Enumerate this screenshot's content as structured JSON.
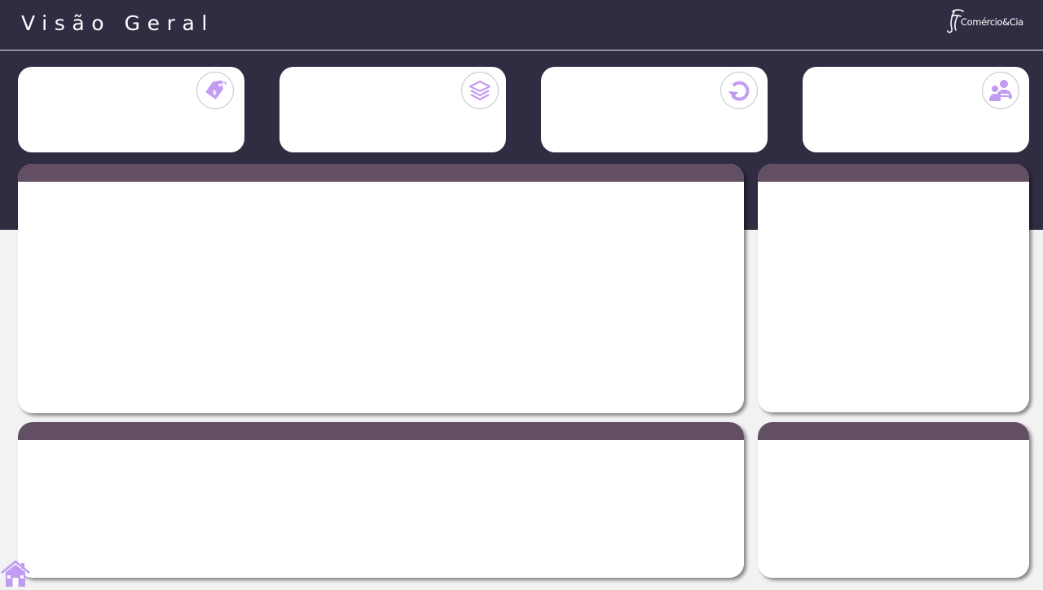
{
  "header": {
    "title": "Visão Geral",
    "logo_text": "Comércio&Cia"
  },
  "kpi_cards": [
    {
      "icon": "price-tag-icon",
      "label": "",
      "value": ""
    },
    {
      "icon": "layers-icon",
      "label": "",
      "value": ""
    },
    {
      "icon": "refresh-icon",
      "label": "",
      "value": ""
    },
    {
      "icon": "user-group-icon",
      "label": "",
      "value": ""
    }
  ],
  "panels": [
    {
      "name": "main-chart-panel",
      "title": ""
    },
    {
      "name": "side-chart-panel",
      "title": ""
    },
    {
      "name": "bottom-chart-panel",
      "title": ""
    },
    {
      "name": "bottom-side-panel",
      "title": ""
    }
  ],
  "nav": {
    "home_icon": "home-icon"
  },
  "colors": {
    "header_background": "#302d42",
    "page_background": "#f2f2f2",
    "panel_header": "#624f64",
    "icon_accent": "#c29bf2"
  }
}
